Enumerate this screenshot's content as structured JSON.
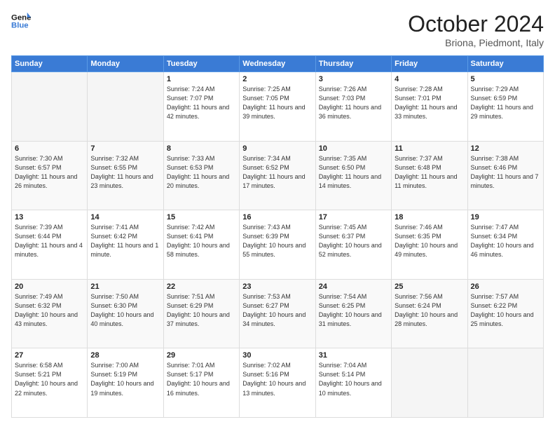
{
  "logo": {
    "line1": "General",
    "line2": "Blue"
  },
  "title": "October 2024",
  "subtitle": "Briona, Piedmont, Italy",
  "days_header": [
    "Sunday",
    "Monday",
    "Tuesday",
    "Wednesday",
    "Thursday",
    "Friday",
    "Saturday"
  ],
  "weeks": [
    [
      {
        "num": "",
        "sunrise": "",
        "sunset": "",
        "daylight": ""
      },
      {
        "num": "",
        "sunrise": "",
        "sunset": "",
        "daylight": ""
      },
      {
        "num": "1",
        "sunrise": "Sunrise: 7:24 AM",
        "sunset": "Sunset: 7:07 PM",
        "daylight": "Daylight: 11 hours and 42 minutes."
      },
      {
        "num": "2",
        "sunrise": "Sunrise: 7:25 AM",
        "sunset": "Sunset: 7:05 PM",
        "daylight": "Daylight: 11 hours and 39 minutes."
      },
      {
        "num": "3",
        "sunrise": "Sunrise: 7:26 AM",
        "sunset": "Sunset: 7:03 PM",
        "daylight": "Daylight: 11 hours and 36 minutes."
      },
      {
        "num": "4",
        "sunrise": "Sunrise: 7:28 AM",
        "sunset": "Sunset: 7:01 PM",
        "daylight": "Daylight: 11 hours and 33 minutes."
      },
      {
        "num": "5",
        "sunrise": "Sunrise: 7:29 AM",
        "sunset": "Sunset: 6:59 PM",
        "daylight": "Daylight: 11 hours and 29 minutes."
      }
    ],
    [
      {
        "num": "6",
        "sunrise": "Sunrise: 7:30 AM",
        "sunset": "Sunset: 6:57 PM",
        "daylight": "Daylight: 11 hours and 26 minutes."
      },
      {
        "num": "7",
        "sunrise": "Sunrise: 7:32 AM",
        "sunset": "Sunset: 6:55 PM",
        "daylight": "Daylight: 11 hours and 23 minutes."
      },
      {
        "num": "8",
        "sunrise": "Sunrise: 7:33 AM",
        "sunset": "Sunset: 6:53 PM",
        "daylight": "Daylight: 11 hours and 20 minutes."
      },
      {
        "num": "9",
        "sunrise": "Sunrise: 7:34 AM",
        "sunset": "Sunset: 6:52 PM",
        "daylight": "Daylight: 11 hours and 17 minutes."
      },
      {
        "num": "10",
        "sunrise": "Sunrise: 7:35 AM",
        "sunset": "Sunset: 6:50 PM",
        "daylight": "Daylight: 11 hours and 14 minutes."
      },
      {
        "num": "11",
        "sunrise": "Sunrise: 7:37 AM",
        "sunset": "Sunset: 6:48 PM",
        "daylight": "Daylight: 11 hours and 11 minutes."
      },
      {
        "num": "12",
        "sunrise": "Sunrise: 7:38 AM",
        "sunset": "Sunset: 6:46 PM",
        "daylight": "Daylight: 11 hours and 7 minutes."
      }
    ],
    [
      {
        "num": "13",
        "sunrise": "Sunrise: 7:39 AM",
        "sunset": "Sunset: 6:44 PM",
        "daylight": "Daylight: 11 hours and 4 minutes."
      },
      {
        "num": "14",
        "sunrise": "Sunrise: 7:41 AM",
        "sunset": "Sunset: 6:42 PM",
        "daylight": "Daylight: 11 hours and 1 minute."
      },
      {
        "num": "15",
        "sunrise": "Sunrise: 7:42 AM",
        "sunset": "Sunset: 6:41 PM",
        "daylight": "Daylight: 10 hours and 58 minutes."
      },
      {
        "num": "16",
        "sunrise": "Sunrise: 7:43 AM",
        "sunset": "Sunset: 6:39 PM",
        "daylight": "Daylight: 10 hours and 55 minutes."
      },
      {
        "num": "17",
        "sunrise": "Sunrise: 7:45 AM",
        "sunset": "Sunset: 6:37 PM",
        "daylight": "Daylight: 10 hours and 52 minutes."
      },
      {
        "num": "18",
        "sunrise": "Sunrise: 7:46 AM",
        "sunset": "Sunset: 6:35 PM",
        "daylight": "Daylight: 10 hours and 49 minutes."
      },
      {
        "num": "19",
        "sunrise": "Sunrise: 7:47 AM",
        "sunset": "Sunset: 6:34 PM",
        "daylight": "Daylight: 10 hours and 46 minutes."
      }
    ],
    [
      {
        "num": "20",
        "sunrise": "Sunrise: 7:49 AM",
        "sunset": "Sunset: 6:32 PM",
        "daylight": "Daylight: 10 hours and 43 minutes."
      },
      {
        "num": "21",
        "sunrise": "Sunrise: 7:50 AM",
        "sunset": "Sunset: 6:30 PM",
        "daylight": "Daylight: 10 hours and 40 minutes."
      },
      {
        "num": "22",
        "sunrise": "Sunrise: 7:51 AM",
        "sunset": "Sunset: 6:29 PM",
        "daylight": "Daylight: 10 hours and 37 minutes."
      },
      {
        "num": "23",
        "sunrise": "Sunrise: 7:53 AM",
        "sunset": "Sunset: 6:27 PM",
        "daylight": "Daylight: 10 hours and 34 minutes."
      },
      {
        "num": "24",
        "sunrise": "Sunrise: 7:54 AM",
        "sunset": "Sunset: 6:25 PM",
        "daylight": "Daylight: 10 hours and 31 minutes."
      },
      {
        "num": "25",
        "sunrise": "Sunrise: 7:56 AM",
        "sunset": "Sunset: 6:24 PM",
        "daylight": "Daylight: 10 hours and 28 minutes."
      },
      {
        "num": "26",
        "sunrise": "Sunrise: 7:57 AM",
        "sunset": "Sunset: 6:22 PM",
        "daylight": "Daylight: 10 hours and 25 minutes."
      }
    ],
    [
      {
        "num": "27",
        "sunrise": "Sunrise: 6:58 AM",
        "sunset": "Sunset: 5:21 PM",
        "daylight": "Daylight: 10 hours and 22 minutes."
      },
      {
        "num": "28",
        "sunrise": "Sunrise: 7:00 AM",
        "sunset": "Sunset: 5:19 PM",
        "daylight": "Daylight: 10 hours and 19 minutes."
      },
      {
        "num": "29",
        "sunrise": "Sunrise: 7:01 AM",
        "sunset": "Sunset: 5:17 PM",
        "daylight": "Daylight: 10 hours and 16 minutes."
      },
      {
        "num": "30",
        "sunrise": "Sunrise: 7:02 AM",
        "sunset": "Sunset: 5:16 PM",
        "daylight": "Daylight: 10 hours and 13 minutes."
      },
      {
        "num": "31",
        "sunrise": "Sunrise: 7:04 AM",
        "sunset": "Sunset: 5:14 PM",
        "daylight": "Daylight: 10 hours and 10 minutes."
      },
      {
        "num": "",
        "sunrise": "",
        "sunset": "",
        "daylight": ""
      },
      {
        "num": "",
        "sunrise": "",
        "sunset": "",
        "daylight": ""
      }
    ]
  ]
}
